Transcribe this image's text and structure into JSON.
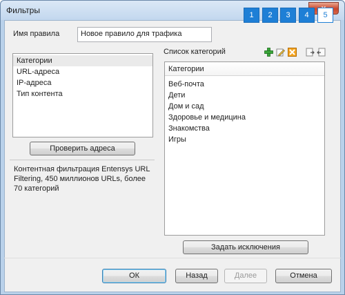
{
  "window": {
    "title": "Фильтры",
    "close_label": "x"
  },
  "rule": {
    "label": "Имя правила",
    "value": "Новое правило для трафика"
  },
  "steps": [
    "1",
    "2",
    "3",
    "4",
    "5"
  ],
  "left_list": {
    "items": [
      "Категории",
      "URL-адреса",
      "IP-адреса",
      "Тип контента"
    ]
  },
  "check_button": "Проверить адреса",
  "info_text": "Контентная фильтрация Entensys URL Filtering, 450 миллионов URLs, более 70 категорий",
  "categories": {
    "label": "Список категорий",
    "header": "Категории",
    "items": [
      "Веб-почта",
      "Дети",
      "Дом и сад",
      "Здоровье и медицина",
      "Знакомства",
      "Игры"
    ]
  },
  "toolbar_icons": [
    "add-icon",
    "edit-icon",
    "delete-icon",
    "import-icon",
    "export-icon"
  ],
  "exceptions_button": "Задать исключения",
  "footer": {
    "ok": "ОК",
    "back": "Назад",
    "next": "Далее",
    "cancel": "Отмена"
  },
  "colors": {
    "accent": "#1e7fd6",
    "title_bar": "#c2d7ee",
    "close": "#c9462c"
  }
}
